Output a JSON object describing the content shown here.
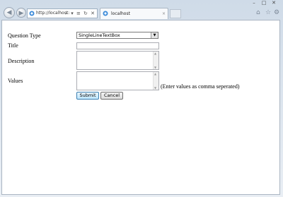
{
  "browser": {
    "address": "http://localhost:",
    "address_tools": "⌕ ▾ ≡ ↻ ✕",
    "tab_title": "localhost",
    "tab_close": "×",
    "window_buttons": [
      "–",
      "□",
      "✕"
    ]
  },
  "form": {
    "question_type_label": "Question Type",
    "question_type_value": "SingleLineTextBox",
    "title_label": "Title",
    "title_value": "",
    "description_label": "Description",
    "description_value": "",
    "values_label": "Values",
    "values_value": "",
    "values_hint": "(Enter values as comma seperated)",
    "submit_label": "Submit",
    "cancel_label": "Cancel"
  }
}
